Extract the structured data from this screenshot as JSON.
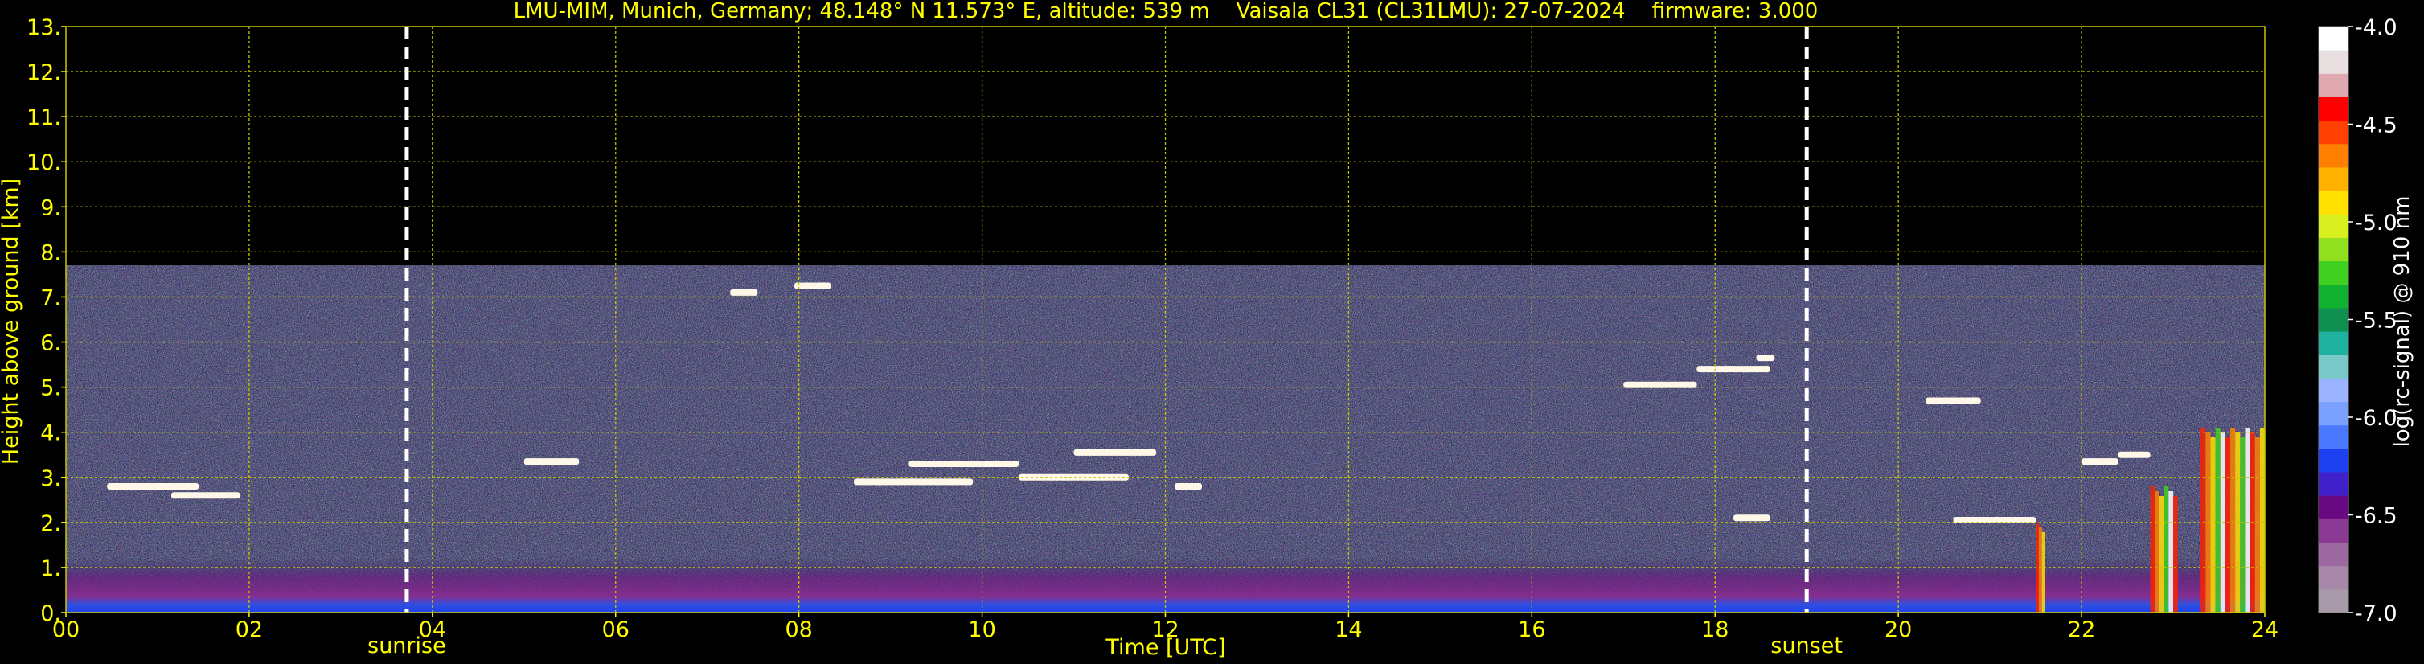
{
  "chart_data": {
    "type": "heatmap",
    "title": "LMU-MIM, Munich, Germany; 48.148° N 11.573° E, altitude: 539 m    Vaisala CL31 (CL31LMU): 27-07-2024    firmware: 3.000",
    "xlabel": "Time [UTC]",
    "ylabel": "Height above ground [km]",
    "xlim": [
      0,
      24
    ],
    "ylim": [
      0,
      13
    ],
    "x_ticks": [
      "00",
      "02",
      "04",
      "06",
      "08",
      "10",
      "12",
      "14",
      "16",
      "18",
      "20",
      "22",
      "24"
    ],
    "y_ticks": [
      "0.",
      "1.",
      "2.",
      "3.",
      "4.",
      "5.",
      "6.",
      "7.",
      "8.",
      "9.",
      "10.",
      "11.",
      "12.",
      "13."
    ],
    "grid": true,
    "grid_color": "#c8c800",
    "colorbar": {
      "label": "log(rc-signal) @ 910 nm",
      "range": [
        -7.0,
        -4.0
      ],
      "ticks": [
        "-4.0",
        "-4.5",
        "-5.0",
        "-5.5",
        "-6.0",
        "-6.5",
        "-7.0"
      ],
      "colors": [
        "#a89aa8",
        "#a888a8",
        "#9c6aa0",
        "#8a3a92",
        "#6a0a82",
        "#4020c8",
        "#1e40f0",
        "#4a78ff",
        "#7aa0ff",
        "#9cb4ff",
        "#7ac8c8",
        "#20b0a0",
        "#109050",
        "#10b030",
        "#40d020",
        "#90e020",
        "#d8f020",
        "#ffe000",
        "#ffb000",
        "#ff8000",
        "#ff4000",
        "#ff0000",
        "#e0a8b0",
        "#e8e0e0",
        "#ffffff"
      ]
    },
    "markers": [
      {
        "label": "sunrise",
        "x": 3.72
      },
      {
        "label": "sunset",
        "x": 19.0
      }
    ],
    "data_top_km": 7.7,
    "cloud_layers": [
      {
        "t0": 0.45,
        "t1": 1.45,
        "h": 2.8
      },
      {
        "t0": 1.15,
        "t1": 1.9,
        "h": 2.6
      },
      {
        "t0": 5.0,
        "t1": 5.6,
        "h": 3.35
      },
      {
        "t0": 7.25,
        "t1": 7.55,
        "h": 7.1
      },
      {
        "t0": 7.95,
        "t1": 8.35,
        "h": 7.25
      },
      {
        "t0": 8.6,
        "t1": 9.9,
        "h": 2.9
      },
      {
        "t0": 9.2,
        "t1": 10.4,
        "h": 3.3
      },
      {
        "t0": 10.4,
        "t1": 11.6,
        "h": 3.0
      },
      {
        "t0": 11.0,
        "t1": 11.9,
        "h": 3.55
      },
      {
        "t0": 12.1,
        "t1": 12.4,
        "h": 2.8
      },
      {
        "t0": 17.0,
        "t1": 17.8,
        "h": 5.05
      },
      {
        "t0": 17.8,
        "t1": 18.6,
        "h": 5.4
      },
      {
        "t0": 18.45,
        "t1": 18.65,
        "h": 5.65
      },
      {
        "t0": 18.2,
        "t1": 18.6,
        "h": 2.1
      },
      {
        "t0": 20.3,
        "t1": 20.9,
        "h": 4.7
      },
      {
        "t0": 20.6,
        "t1": 21.5,
        "h": 2.05
      },
      {
        "t0": 22.0,
        "t1": 22.4,
        "h": 3.35
      },
      {
        "t0": 22.4,
        "t1": 22.75,
        "h": 3.5
      }
    ],
    "precipitation": [
      {
        "t0": 21.5,
        "t1": 21.6,
        "h": 2.0
      },
      {
        "t0": 22.75,
        "t1": 23.05,
        "h": 2.8
      },
      {
        "t0": 23.3,
        "t1": 24.0,
        "h": 4.1
      }
    ]
  }
}
